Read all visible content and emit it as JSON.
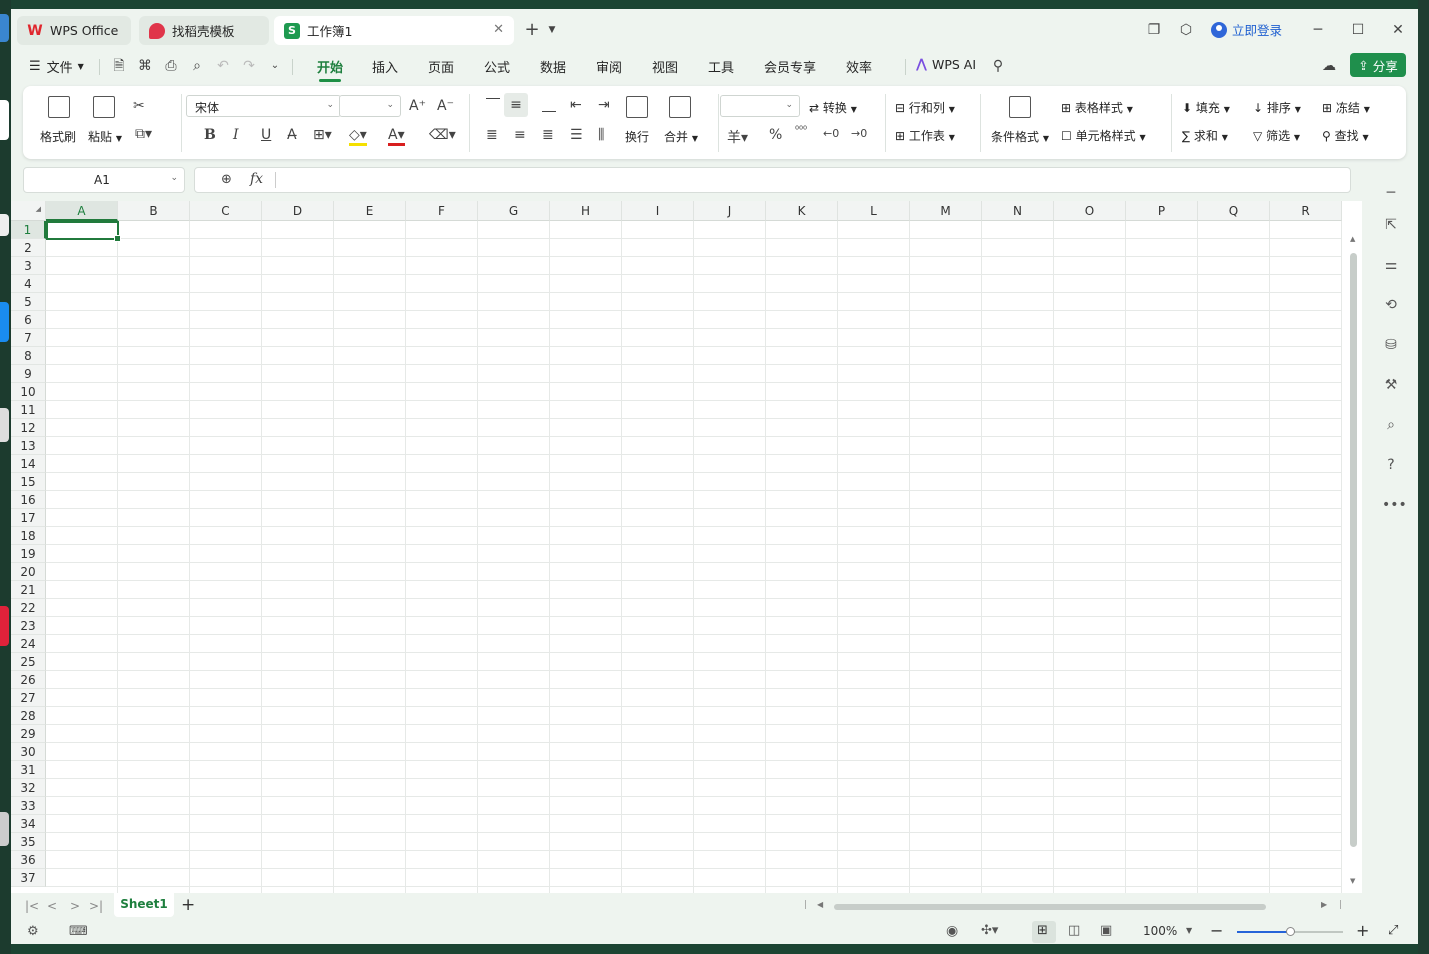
{
  "titlebar": {
    "tabs": [
      {
        "label": "WPS Office"
      },
      {
        "label": "找稻壳模板"
      },
      {
        "label": "工作簿1"
      }
    ],
    "login_label": "立即登录"
  },
  "menubar": {
    "file_label": "文件",
    "items": [
      "开始",
      "插入",
      "页面",
      "公式",
      "数据",
      "审阅",
      "视图",
      "工具",
      "会员专享",
      "效率"
    ],
    "active_item": "开始",
    "ai_label": "WPS AI",
    "share_label": "分享"
  },
  "ribbon": {
    "format_painter": "格式刷",
    "paste": "粘贴",
    "font_name": "宋体",
    "font_size": "",
    "wrap": "换行",
    "merge": "合并",
    "number_format": "",
    "convert": "转换",
    "row_col": "行和列",
    "worksheet": "工作表",
    "cond_format": "条件格式",
    "table_style": "表格样式",
    "cell_style": "单元格样式",
    "fill": "填充",
    "sort": "排序",
    "freeze": "冻结",
    "sum": "求和",
    "filter": "筛选",
    "find": "查找",
    "bold": "B",
    "italic": "I",
    "underline": "U",
    "currency": "羊",
    "percent": "%"
  },
  "formula_bar": {
    "name_box": "A1",
    "fx_label": "fx",
    "formula": ""
  },
  "sheet": {
    "columns": [
      "A",
      "B",
      "C",
      "D",
      "E",
      "F",
      "G",
      "H",
      "I",
      "J",
      "K",
      "L",
      "M",
      "N",
      "O",
      "P",
      "Q",
      "R"
    ],
    "rows": [
      "1",
      "2",
      "3",
      "4",
      "5",
      "6",
      "7",
      "8",
      "9",
      "10",
      "11",
      "12",
      "13",
      "14",
      "15",
      "16",
      "17",
      "18",
      "19",
      "20",
      "21",
      "22",
      "23",
      "24",
      "25",
      "26",
      "27",
      "28",
      "29",
      "30",
      "31",
      "32",
      "33",
      "34",
      "35",
      "36",
      "37"
    ],
    "selected_cell": "A1"
  },
  "sheet_tabs": {
    "tabs": [
      "Sheet1"
    ],
    "active": "Sheet1"
  },
  "statusbar": {
    "zoom": "100%"
  },
  "colors": {
    "accent": "#1e8f45",
    "active_tab_text": "#1e7f3e",
    "selection": "#217a3c",
    "login": "#1f5fd0",
    "window_bg": "#eef4ef"
  }
}
